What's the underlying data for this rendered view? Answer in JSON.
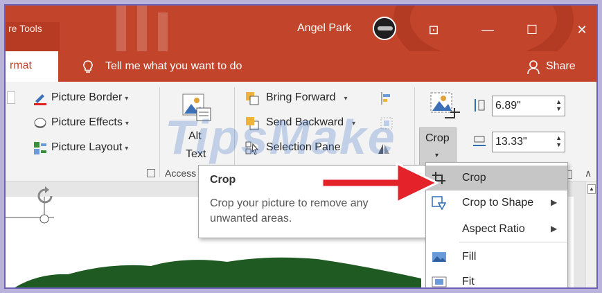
{
  "titlebar": {
    "tool_tab": "re Tools",
    "user_name": "Angel Park",
    "window_controls": [
      "⊡",
      "—",
      "☐",
      "✕"
    ]
  },
  "tabs": {
    "format_label": "rmat",
    "tell_me": "Tell me what you want to do",
    "share": "Share"
  },
  "ribbon": {
    "picture_styles": [
      "Picture Border",
      "Picture Effects",
      "Picture Layout"
    ],
    "alt_text": [
      "Alt",
      "Text"
    ],
    "accessibility_label": "Access",
    "arrange": [
      "Bring Forward",
      "Send Backward",
      "Selection Pane"
    ],
    "crop_label": "Crop",
    "height_value": "6.89\"",
    "width_value": "13.33\""
  },
  "tooltip": {
    "title": "Crop",
    "body": "Crop your picture to remove any unwanted areas."
  },
  "crop_menu": {
    "items": [
      {
        "label": "Crop",
        "icon": "crop-icon",
        "submenu": false
      },
      {
        "label": "Crop to Shape",
        "icon": "crop-shape-icon",
        "submenu": true
      },
      {
        "label": "Aspect Ratio",
        "icon": "",
        "submenu": true
      },
      {
        "label": "Fill",
        "icon": "fill-icon",
        "submenu": false
      },
      {
        "label": "Fit",
        "icon": "fit-icon",
        "submenu": false
      }
    ]
  },
  "watermark": "TipsMake",
  "colors": {
    "accent": "#c2452b",
    "arrow": "#e3222a",
    "map_green": "#1e5a22"
  }
}
